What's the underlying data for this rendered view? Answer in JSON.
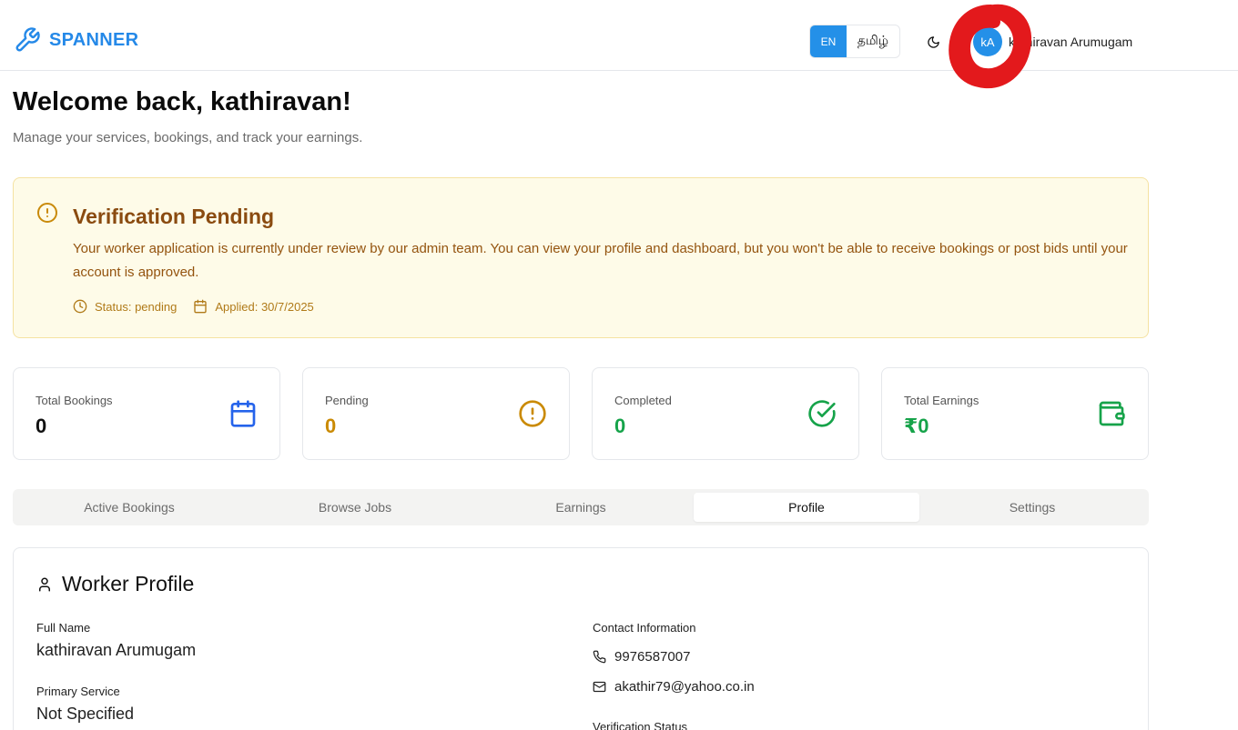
{
  "header": {
    "brand": "SPANNER",
    "lang_en": "EN",
    "lang_ta": "தமிழ்",
    "avatar_initials": "kA",
    "user_name": "kathiravan Arumugam"
  },
  "welcome": {
    "title": "Welcome back, kathiravan!",
    "subtitle": "Manage your services, bookings, and track your earnings."
  },
  "alert": {
    "title": "Verification Pending",
    "message": "Your worker application is currently under review by our admin team. You can view your profile and dashboard, but you won't be able to receive bookings or post bids until your account is approved.",
    "status": "Status: pending",
    "applied": "Applied: 30/7/2025"
  },
  "stats": [
    {
      "label": "Total Bookings",
      "value": "0",
      "color": "#111111",
      "icon": "calendar-icon",
      "icon_color": "#2563eb"
    },
    {
      "label": "Pending",
      "value": "0",
      "color": "#ca8a04",
      "icon": "alert-circle-icon",
      "icon_color": "#ca8a04"
    },
    {
      "label": "Completed",
      "value": "0",
      "color": "#16a34a",
      "icon": "check-circle-icon",
      "icon_color": "#16a34a"
    },
    {
      "label": "Total Earnings",
      "value": "₹0",
      "color": "#16a34a",
      "icon": "wallet-icon",
      "icon_color": "#16a34a"
    }
  ],
  "tabs": [
    {
      "label": "Active Bookings",
      "active": false
    },
    {
      "label": "Browse Jobs",
      "active": false
    },
    {
      "label": "Earnings",
      "active": false
    },
    {
      "label": "Profile",
      "active": true
    },
    {
      "label": "Settings",
      "active": false
    }
  ],
  "profile": {
    "title": "Worker Profile",
    "full_name_label": "Full Name",
    "full_name": "kathiravan Arumugam",
    "primary_service_label": "Primary Service",
    "primary_service": "Not Specified",
    "contact_label": "Contact Information",
    "phone": "9976587007",
    "email": "akathir79@yahoo.co.in",
    "verification_label": "Verification Status"
  },
  "colors": {
    "brand": "#2589e8",
    "annotation": "#e3191c"
  }
}
